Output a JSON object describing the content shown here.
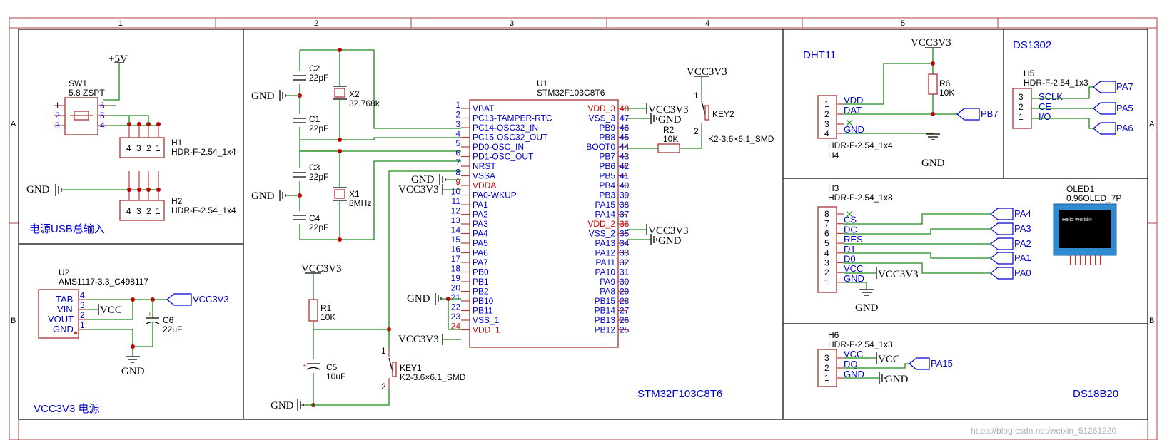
{
  "frame": {
    "columns": [
      "1",
      "2",
      "3",
      "4",
      "5"
    ],
    "rows": [
      "A",
      "B"
    ]
  },
  "sections": {
    "usb_power": "电源USB总输入",
    "vcc_power": "VCC3V3 电源",
    "mcu": "STM32F103C8T6",
    "dht11": "DHT11",
    "ds1302": "DS1302",
    "ds18b20": "DS18B20"
  },
  "nets": {
    "p5v": "+5V",
    "gnd": "GND",
    "vcc3v3": "VCC3V3",
    "vcc": "VCC"
  },
  "components": {
    "sw1": {
      "ref": "SW1",
      "value": "5.8 ZSPT",
      "pins": [
        "1",
        "2",
        "3",
        "6",
        "5",
        "4"
      ]
    },
    "h1": {
      "ref": "H1",
      "value": "HDR-F-2.54_1x4",
      "pins": [
        "4",
        "3",
        "2",
        "1"
      ]
    },
    "h2": {
      "ref": "H2",
      "value": "HDR-F-2.54_1x4",
      "pins": [
        "4",
        "3",
        "2",
        "1"
      ]
    },
    "u2": {
      "ref": "U2",
      "value": "AMS1117-3.3_C498117",
      "pin_names": [
        "TAB",
        "VIN",
        "VOUT",
        "GND"
      ],
      "pin_numbers": [
        "4",
        "3",
        "2",
        "1"
      ]
    },
    "c6": {
      "ref": "C6",
      "value": "22uF"
    },
    "c2": {
      "ref": "C2",
      "value": "22pF"
    },
    "c1": {
      "ref": "C1",
      "value": "22pF"
    },
    "x2": {
      "ref": "X2",
      "value": "32.768k"
    },
    "c3": {
      "ref": "C3",
      "value": "22pF"
    },
    "c4": {
      "ref": "C4",
      "value": "22pF"
    },
    "x1": {
      "ref": "X1",
      "value": "8MHz"
    },
    "r1": {
      "ref": "R1",
      "value": "10K"
    },
    "c5": {
      "ref": "C5",
      "value": "10uF"
    },
    "key1": {
      "ref": "KEY1",
      "value": "K2-3.6×6.1_SMD",
      "pins": [
        "1",
        "2"
      ]
    },
    "key2": {
      "ref": "KEY2",
      "value": "K2-3.6×6.1_SMD",
      "pins": [
        "1",
        "2"
      ]
    },
    "r2": {
      "ref": "R2",
      "value": "10K"
    },
    "r6": {
      "ref": "R6",
      "value": "10K"
    },
    "u1": {
      "ref": "U1",
      "value": "STM32F103C8T6",
      "left_pins": [
        {
          "num": "1",
          "name": "VBAT"
        },
        {
          "num": "2",
          "name": "PC13-TAMPER-RTC"
        },
        {
          "num": "3",
          "name": "PC14-OSC32_IN"
        },
        {
          "num": "4",
          "name": "PC15-OSC32_OUT"
        },
        {
          "num": "5",
          "name": "PD0-OSC_IN"
        },
        {
          "num": "6",
          "name": "PD1-OSC_OUT"
        },
        {
          "num": "7",
          "name": "NRST"
        },
        {
          "num": "8",
          "name": "VSSA"
        },
        {
          "num": "9",
          "name": "VDDA"
        },
        {
          "num": "10",
          "name": "PA0-WKUP"
        },
        {
          "num": "11",
          "name": "PA1"
        },
        {
          "num": "12",
          "name": "PA2"
        },
        {
          "num": "13",
          "name": "PA3"
        },
        {
          "num": "14",
          "name": "PA4"
        },
        {
          "num": "15",
          "name": "PA5"
        },
        {
          "num": "16",
          "name": "PA6"
        },
        {
          "num": "17",
          "name": "PA7"
        },
        {
          "num": "18",
          "name": "PB0"
        },
        {
          "num": "19",
          "name": "PB1"
        },
        {
          "num": "20",
          "name": "PB2"
        },
        {
          "num": "21",
          "name": "PB10"
        },
        {
          "num": "22",
          "name": "PB11"
        },
        {
          "num": "23",
          "name": "VSS_1"
        },
        {
          "num": "24",
          "name": "VDD_1"
        }
      ],
      "right_pins": [
        {
          "num": "48",
          "name": "VDD_3"
        },
        {
          "num": "47",
          "name": "VSS_3"
        },
        {
          "num": "46",
          "name": "PB9"
        },
        {
          "num": "45",
          "name": "PB8"
        },
        {
          "num": "44",
          "name": "BOOT0"
        },
        {
          "num": "43",
          "name": "PB7"
        },
        {
          "num": "42",
          "name": "PB6"
        },
        {
          "num": "41",
          "name": "PB5"
        },
        {
          "num": "40",
          "name": "PB4"
        },
        {
          "num": "39",
          "name": "PB3"
        },
        {
          "num": "38",
          "name": "PA15"
        },
        {
          "num": "37",
          "name": "PA14"
        },
        {
          "num": "36",
          "name": "VDD_2"
        },
        {
          "num": "35",
          "name": "VSS_2"
        },
        {
          "num": "34",
          "name": "PA13"
        },
        {
          "num": "33",
          "name": "PA12"
        },
        {
          "num": "32",
          "name": "PA11"
        },
        {
          "num": "31",
          "name": "PA10"
        },
        {
          "num": "30",
          "name": "PA9"
        },
        {
          "num": "29",
          "name": "PA8"
        },
        {
          "num": "28",
          "name": "PB15"
        },
        {
          "num": "27",
          "name": "PB14"
        },
        {
          "num": "26",
          "name": "PB13"
        },
        {
          "num": "25",
          "name": "PB12"
        }
      ]
    },
    "h4": {
      "ref": "H4",
      "value": "HDR-F-2.54_1x4",
      "pin_names": [
        "VDD",
        "DAT",
        "",
        "GND"
      ],
      "pin_numbers": [
        "1",
        "2",
        "3",
        "4"
      ]
    },
    "h5": {
      "ref": "H5",
      "value": "HDR-F-2.54_1x3",
      "pin_names": [
        "SCLK",
        "CE",
        "I/O"
      ],
      "pin_numbers": [
        "3",
        "2",
        "1"
      ]
    },
    "h3": {
      "ref": "H3",
      "value": "HDR-F-2.54_1x8",
      "pin_names": [
        "",
        "CS",
        "DC",
        "RES",
        "D1",
        "D0",
        "VCC",
        "GND"
      ],
      "pin_numbers": [
        "8",
        "7",
        "6",
        "5",
        "4",
        "3",
        "2",
        "1"
      ]
    },
    "oled1": {
      "ref": "OLED1",
      "value": "0.96OLED_7P",
      "screen_text": "Hello World!!!"
    },
    "h6": {
      "ref": "H6",
      "value": "HDR-F-2.54_1x3",
      "pin_names": [
        "VCC",
        "DQ",
        "GND"
      ],
      "pin_numbers": [
        "3",
        "2",
        "1"
      ]
    }
  },
  "ports": {
    "u2_out": "VCC3V3",
    "dht_dat": "PB7",
    "ds1302": [
      "PA7",
      "PA5",
      "PA6"
    ],
    "oled": [
      "PA4",
      "PA3",
      "PA2",
      "PA1",
      "PA0"
    ],
    "ds18b20": "PA15"
  },
  "watermark": "https://blog.csdn.net/weixin_51261220"
}
